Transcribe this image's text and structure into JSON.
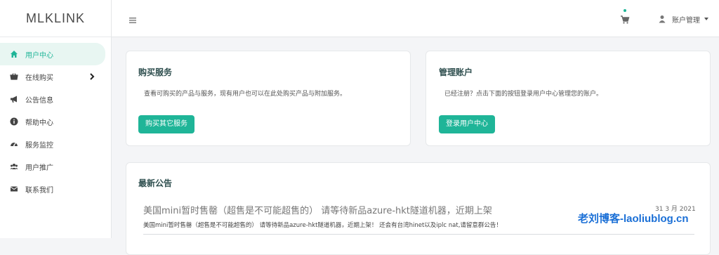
{
  "brand": "MLKLINK",
  "sidebar": {
    "items": [
      {
        "label": "用户中心",
        "icon": "home-icon"
      },
      {
        "label": "在线购买",
        "icon": "basket-icon"
      },
      {
        "label": "公告信息",
        "icon": "bullhorn-icon"
      },
      {
        "label": "帮助中心",
        "icon": "info-circle-icon"
      },
      {
        "label": "服务监控",
        "icon": "dashboard-icon"
      },
      {
        "label": "用户推广",
        "icon": "users-icon"
      },
      {
        "label": "联系我们",
        "icon": "envelope-icon"
      }
    ]
  },
  "header": {
    "account_label": "账户管理"
  },
  "buy_card": {
    "title": "购买服务",
    "desc": "查看可购买的产品与服务，现有用户也可以在此处购买产品与附加服务。",
    "button": "购买其它服务"
  },
  "account_card": {
    "title": "管理账户",
    "desc": "已经注册？点击下面的按钮登录用户中心管理您的账户。",
    "button": "登录用户中心"
  },
  "news": {
    "title": "最新公告",
    "items": [
      {
        "headline": "美国mini暂时售罄（超售是不可能超售的） 请等待新品azure-hkt隧道机器，近期上架",
        "date": "31 3 月 2021",
        "body": "美国mini暂时售罄（超售是不可能超售的） 请等待新品azure-hkt隧道机器，近期上架！ 还会有台湾hinet以及iplc nat,请留意群公告！"
      }
    ]
  },
  "watermark": "老刘博客-laoliublog.cn",
  "colors": {
    "accent": "#1fb598",
    "active_bg": "#e8f6f2",
    "watermark": "#1a6fd6"
  }
}
